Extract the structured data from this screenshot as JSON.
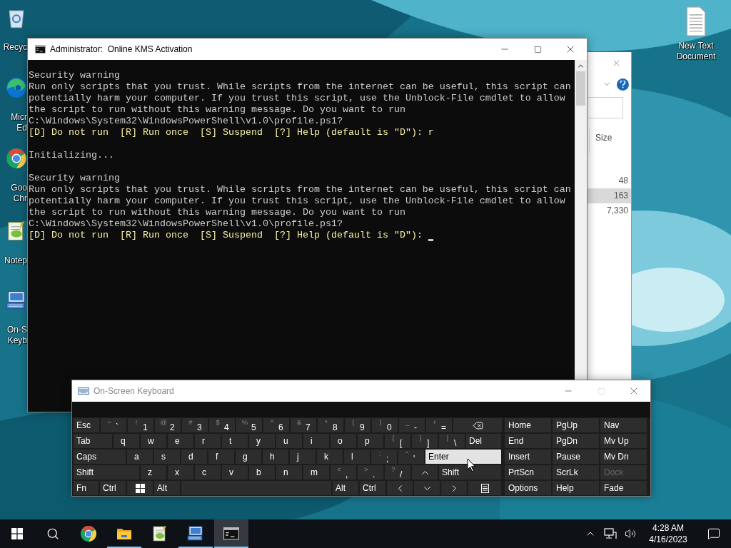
{
  "desktop_icons": [
    {
      "kind": "recycle-bin",
      "lines": [
        "Recyc"
      ]
    },
    {
      "kind": "edge",
      "lines": [
        "Micr",
        "Ed"
      ]
    },
    {
      "kind": "chrome",
      "lines": [
        "Goo",
        "Chr"
      ]
    },
    {
      "kind": "notepad",
      "lines": [
        "Notep"
      ]
    },
    {
      "kind": "keyboard",
      "lines": [
        "On-S",
        "Keyb"
      ]
    }
  ],
  "desktop_files": [
    {
      "kind": "text-file",
      "lines": [
        "New Text",
        "Document"
      ]
    }
  ],
  "explorer": {
    "column": "Size",
    "rows": [
      {
        "value": "48",
        "selected": false
      },
      {
        "value": "163",
        "selected": true
      },
      {
        "value": "7,330",
        "selected": false
      }
    ]
  },
  "console": {
    "title": "Administrator:  Online KMS Activation",
    "lines": [
      {
        "kind": "normal",
        "text": "Security warning",
        "cursor": false
      },
      {
        "kind": "normal",
        "text": "Run only scripts that you trust. While scripts from the internet can be useful, this script can",
        "cursor": false
      },
      {
        "kind": "normal",
        "text": "potentially harm your computer. If you trust this script, use the Unblock-File cmdlet to allow",
        "cursor": false
      },
      {
        "kind": "normal",
        "text": "the script to run without this warning message. Do you want to run",
        "cursor": false
      },
      {
        "kind": "normal",
        "text": "C:\\Windows\\System32\\WindowsPowerShell\\v1.0\\profile.ps1?",
        "cursor": false
      },
      {
        "kind": "prompt",
        "text": "[D] Do not run  [R] Run once  [S] Suspend  [?] Help (default is \"D\"): r",
        "cursor": false
      },
      {
        "kind": "blank",
        "cursor": false
      },
      {
        "kind": "normal",
        "text": "Initializing...",
        "cursor": false
      },
      {
        "kind": "blank",
        "cursor": false
      },
      {
        "kind": "normal",
        "text": "Security warning",
        "cursor": false
      },
      {
        "kind": "normal",
        "text": "Run only scripts that you trust. While scripts from the internet can be useful, this script can",
        "cursor": false
      },
      {
        "kind": "normal",
        "text": "potentially harm your computer. If you trust this script, use the Unblock-File cmdlet to allow",
        "cursor": false
      },
      {
        "kind": "normal",
        "text": "the script to run without this warning message. Do you want to run",
        "cursor": false
      },
      {
        "kind": "normal",
        "text": "C:\\Windows\\System32\\WindowsPowerShell\\v1.0\\profile.ps1?",
        "cursor": false
      },
      {
        "kind": "prompt",
        "text": "[D] Do not run  [R] Run once  [S] Suspend  [?] Help (default is \"D\"): ",
        "cursor": true
      }
    ]
  },
  "keyboard": {
    "title": "On-Screen Keyboard",
    "rows": [
      [
        {
          "kind": "text",
          "label": "Esc",
          "highlighted": false
        },
        {
          "kind": "shifted",
          "shift": "~",
          "label": "`",
          "highlighted": false
        },
        {
          "kind": "shifted",
          "shift": "!",
          "label": "1",
          "highlighted": false
        },
        {
          "kind": "shifted",
          "shift": "@",
          "label": "2",
          "highlighted": false
        },
        {
          "kind": "shifted",
          "shift": "#",
          "label": "3",
          "highlighted": false
        },
        {
          "kind": "shifted",
          "shift": "$",
          "label": "4",
          "highlighted": false
        },
        {
          "kind": "shifted",
          "shift": "%",
          "label": "5",
          "highlighted": false
        },
        {
          "kind": "shifted",
          "shift": "^",
          "label": "6",
          "highlighted": false
        },
        {
          "kind": "shifted",
          "shift": "&",
          "label": "7",
          "highlighted": false
        },
        {
          "kind": "shifted",
          "shift": "*",
          "label": "8",
          "highlighted": false
        },
        {
          "kind": "shifted",
          "shift": "(",
          "label": "9",
          "highlighted": false
        },
        {
          "kind": "shifted",
          "shift": ")",
          "label": "0",
          "highlighted": false
        },
        {
          "kind": "shifted",
          "shift": "_",
          "label": "-",
          "highlighted": false
        },
        {
          "kind": "shifted",
          "shift": "+",
          "label": "=",
          "highlighted": false
        },
        {
          "kind": "backspace",
          "highlighted": false
        }
      ],
      [
        {
          "kind": "text",
          "label": "Tab",
          "highlighted": false
        },
        {
          "kind": "letter",
          "label": "q",
          "highlighted": false
        },
        {
          "kind": "letter",
          "label": "w",
          "highlighted": false
        },
        {
          "kind": "letter",
          "label": "e",
          "highlighted": false
        },
        {
          "kind": "letter",
          "label": "r",
          "highlighted": false
        },
        {
          "kind": "letter",
          "label": "t",
          "highlighted": false
        },
        {
          "kind": "letter",
          "label": "y",
          "highlighted": false
        },
        {
          "kind": "letter",
          "label": "u",
          "highlighted": false
        },
        {
          "kind": "letter",
          "label": "i",
          "highlighted": false
        },
        {
          "kind": "letter",
          "label": "o",
          "highlighted": false
        },
        {
          "kind": "letter",
          "label": "p",
          "highlighted": false
        },
        {
          "kind": "shifted",
          "shift": "{",
          "label": "[",
          "highlighted": false
        },
        {
          "kind": "shifted",
          "shift": "}",
          "label": "]",
          "highlighted": false
        },
        {
          "kind": "shifted",
          "shift": "|",
          "label": "\\",
          "highlighted": false
        },
        {
          "kind": "text",
          "label": "Del",
          "highlighted": false
        }
      ],
      [
        {
          "kind": "text",
          "label": "Caps",
          "highlighted": false
        },
        {
          "kind": "letter",
          "label": "a",
          "highlighted": false
        },
        {
          "kind": "letter",
          "label": "s",
          "highlighted": false
        },
        {
          "kind": "letter",
          "label": "d",
          "highlighted": false
        },
        {
          "kind": "letter",
          "label": "f",
          "highlighted": false
        },
        {
          "kind": "letter",
          "label": "g",
          "highlighted": false
        },
        {
          "kind": "letter",
          "label": "h",
          "highlighted": false
        },
        {
          "kind": "letter",
          "label": "j",
          "highlighted": false
        },
        {
          "kind": "letter",
          "label": "k",
          "highlighted": false
        },
        {
          "kind": "letter",
          "label": "l",
          "highlighted": false
        },
        {
          "kind": "shifted",
          "shift": ":",
          "label": ";",
          "highlighted": false
        },
        {
          "kind": "shifted",
          "shift": "\"",
          "label": "'",
          "highlighted": false
        },
        {
          "kind": "text",
          "label": "Enter",
          "highlighted": true
        }
      ],
      [
        {
          "kind": "text",
          "label": "Shift",
          "highlighted": false
        },
        {
          "kind": "letter",
          "label": "z",
          "highlighted": false
        },
        {
          "kind": "letter",
          "label": "x",
          "highlighted": false
        },
        {
          "kind": "letter",
          "label": "c",
          "highlighted": false
        },
        {
          "kind": "letter",
          "label": "v",
          "highlighted": false
        },
        {
          "kind": "letter",
          "label": "b",
          "highlighted": false
        },
        {
          "kind": "letter",
          "label": "n",
          "highlighted": false
        },
        {
          "kind": "letter",
          "label": "m",
          "highlighted": false
        },
        {
          "kind": "shifted",
          "shift": "<",
          "label": ",",
          "highlighted": false
        },
        {
          "kind": "shifted",
          "shift": ">",
          "label": ".",
          "highlighted": false
        },
        {
          "kind": "shifted",
          "shift": "?",
          "label": "/",
          "highlighted": false
        },
        {
          "kind": "up",
          "highlighted": false
        },
        {
          "kind": "text",
          "label": "Shift",
          "highlighted": false
        }
      ],
      [
        {
          "kind": "text",
          "label": "Fn",
          "highlighted": false
        },
        {
          "kind": "text",
          "label": "Ctrl",
          "highlighted": false
        },
        {
          "kind": "windows",
          "highlighted": false
        },
        {
          "kind": "text",
          "label": "Alt",
          "highlighted": false
        },
        {
          "kind": "space",
          "highlighted": false
        },
        {
          "kind": "text",
          "label": "Alt",
          "highlighted": false
        },
        {
          "kind": "text",
          "label": "Ctrl",
          "highlighted": false
        },
        {
          "kind": "left",
          "highlighted": false
        },
        {
          "kind": "down",
          "highlighted": false
        },
        {
          "kind": "right",
          "highlighted": false
        },
        {
          "kind": "menu",
          "highlighted": false
        }
      ]
    ],
    "nav_keys": [
      {
        "label": "Home",
        "disabled": false
      },
      {
        "label": "PgUp",
        "disabled": false
      },
      {
        "label": "Nav",
        "disabled": false
      },
      {
        "label": "End",
        "disabled": false
      },
      {
        "label": "PgDn",
        "disabled": false
      },
      {
        "label": "Mv Up",
        "disabled": false
      },
      {
        "label": "Insert",
        "disabled": false
      },
      {
        "label": "Pause",
        "disabled": false
      },
      {
        "label": "Mv Dn",
        "disabled": false
      },
      {
        "label": "PrtScn",
        "disabled": false
      },
      {
        "label": "ScrLk",
        "disabled": false
      },
      {
        "label": "Dock",
        "disabled": true
      },
      {
        "label": "Options",
        "disabled": false
      },
      {
        "label": "Help",
        "disabled": false
      },
      {
        "label": "Fade",
        "disabled": false
      }
    ]
  },
  "taskbar": {
    "items": [
      {
        "kind": "start",
        "running": false,
        "selected": false
      },
      {
        "kind": "search",
        "running": false,
        "selected": false
      },
      {
        "kind": "chrome",
        "running": false,
        "selected": false
      },
      {
        "kind": "explorer",
        "running": true,
        "selected": false
      },
      {
        "kind": "notepad",
        "running": false,
        "selected": false
      },
      {
        "kind": "keyboard",
        "running": true,
        "selected": false
      },
      {
        "kind": "console",
        "running": true,
        "selected": true
      }
    ],
    "time": "4:28 AM",
    "date": "4/16/2023"
  }
}
